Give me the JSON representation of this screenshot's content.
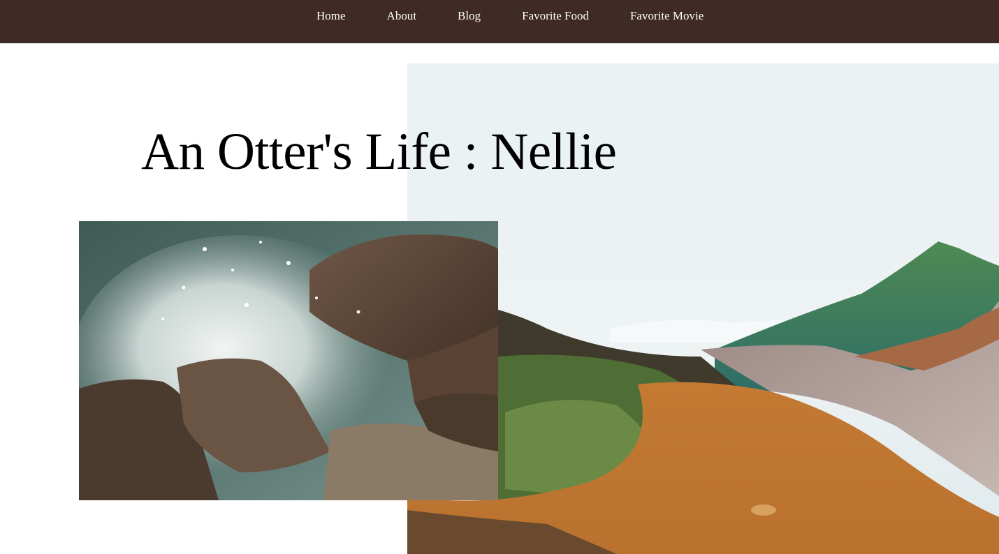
{
  "nav": {
    "items": [
      {
        "label": "Home"
      },
      {
        "label": "About"
      },
      {
        "label": "Blog"
      },
      {
        "label": "Favorite Food"
      },
      {
        "label": "Favorite Movie"
      }
    ]
  },
  "hero": {
    "title": "An Otter's Life : Nellie"
  },
  "colors": {
    "nav_background": "#3f2a25",
    "nav_text": "#ffffff",
    "page_background": "#ffffff",
    "title_text": "#000000"
  }
}
